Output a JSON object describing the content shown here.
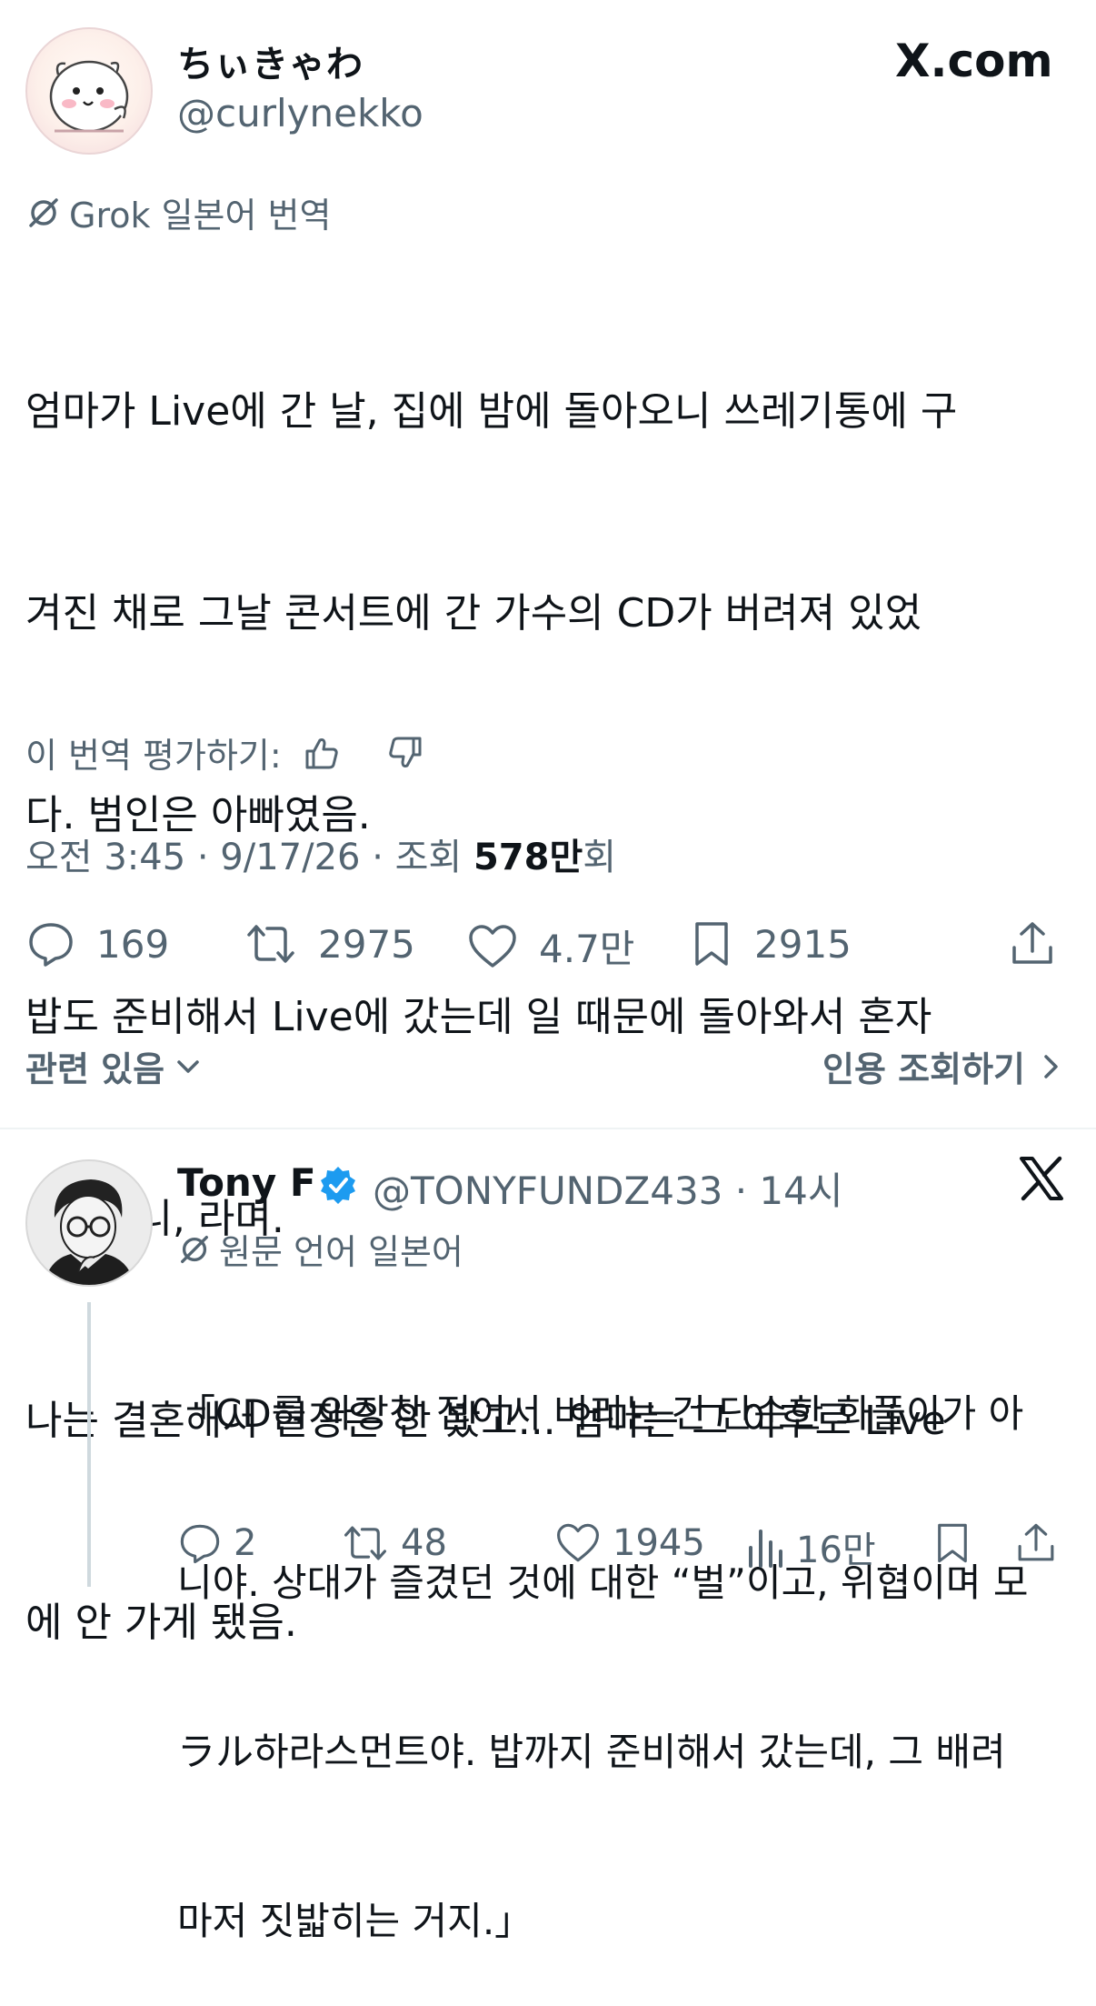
{
  "tweet": {
    "display_name": "ちぃきゃわ",
    "handle": "@curlynekko",
    "site_logo": "X.com",
    "translation_label": "Grok 일본어 번역",
    "body_lines": [
      "엄마가 Live에 간 날, 집에 밤에 돌아오니 쓰레기통에 구",
      "겨진 채로 그날 콘서트에 간 가수의 CD가 버려져 있었",
      "다. 범인은 아빠였음.",
      "밥도 준비해서 Live에 갔는데 일 때문에 돌아와서 혼자",
      "즐기다니, 라며.",
      "나는 결혼해서 현장은 안 봤고... 엄마는 그 이후로 Live",
      "에 안 가게 됐음."
    ],
    "rate_label": "이 번역 평가하기:",
    "meta_prefix": "오전 3:45 · 9/17/26 · 조회 ",
    "views_count": "578만",
    "views_suffix": "회",
    "stats": {
      "replies": "169",
      "retweets": "2975",
      "likes": "4.7만",
      "bookmarks": "2915"
    },
    "related_label": "관련 있음",
    "quotes_label": "인용 조회하기"
  },
  "reply": {
    "display_name": "Tony F",
    "handle_time": "@TONYFUNDZ433 · 14시",
    "language_label": "원문 언어 일본어",
    "body_lines": [
      "「CD를 와장창 접어서 버리는 건 단순한 화풀이가 아",
      "니야. 상대가 즐겼던 것에 대한 “벌”이고, 위협이며 모",
      "ラル하라스먼트야. 밥까지 준비해서 갔는데, 그 배려",
      "마저 짓밟히는 거지.」"
    ],
    "stats": {
      "replies": "2",
      "retweets": "48",
      "likes": "1945",
      "views": "16만"
    }
  },
  "colors": {
    "text": "#0f1419",
    "secondary": "#536471",
    "verified": "#1d9bf0",
    "divider": "#eff3f4"
  }
}
